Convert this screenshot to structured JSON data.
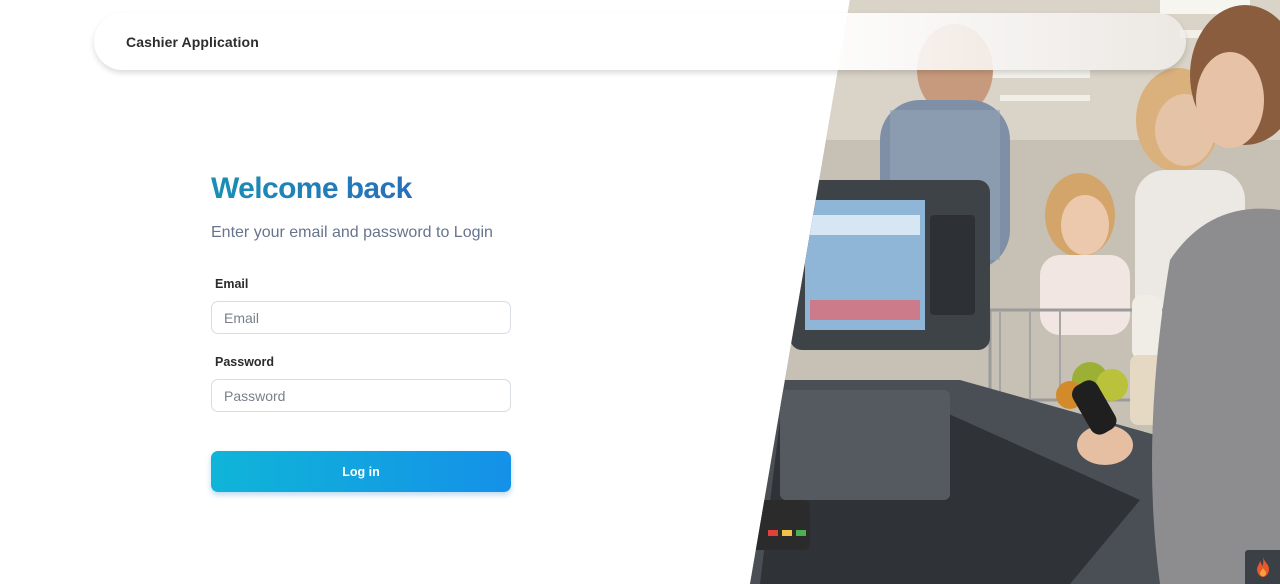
{
  "header": {
    "app_title": "Cashier Application"
  },
  "login": {
    "title": "Welcome back",
    "subtitle": "Enter your email and password to Login",
    "email": {
      "label": "Email",
      "placeholder": "Email",
      "value": ""
    },
    "password": {
      "label": "Password",
      "placeholder": "Password",
      "value": ""
    },
    "submit_label": "Log in"
  },
  "photo": {
    "subject": "cashier-checkout-photo"
  },
  "toolbar": {
    "icon": "flame-icon"
  },
  "colors": {
    "title_gradient_start": "#1a8fb3",
    "title_gradient_end": "#2f5fc0",
    "button_gradient_start": "#0fb5d8",
    "button_gradient_end": "#1591e8",
    "subtitle": "#67748e"
  }
}
